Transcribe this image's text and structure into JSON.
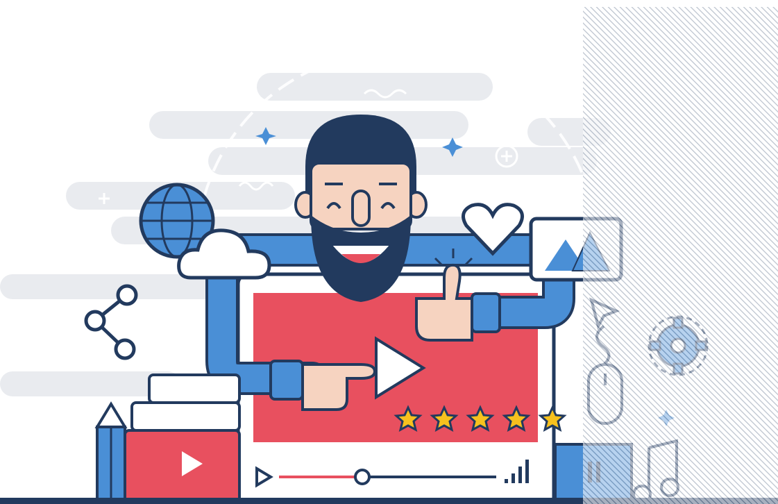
{
  "illustration": {
    "subject": "man-with-video-player",
    "rating_stars": 5,
    "rating_of": 5,
    "progress_fraction": 0.3,
    "colors": {
      "navy": "#223a5e",
      "blue": "#4a8fd6",
      "red": "#e8505f",
      "skin": "#f6d3c0",
      "gold": "#f7c11e",
      "cloud": "#e6e8ed",
      "panel": "#dfe3ea"
    },
    "icons": [
      "globe-icon",
      "cloud-icon",
      "share-icon",
      "heart-icon",
      "image-icon",
      "thumbs-up-icon",
      "play-icon",
      "star-icon",
      "cursor-icon",
      "mouse-icon",
      "gear-icon",
      "pencil-icon",
      "book-icon",
      "music-note-icon",
      "signal-icon"
    ]
  }
}
